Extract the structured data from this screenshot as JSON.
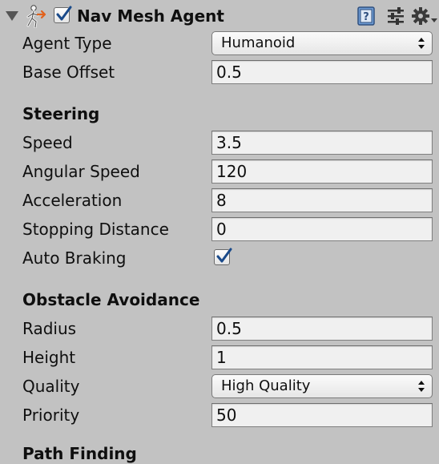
{
  "header": {
    "title": "Nav Mesh Agent",
    "enabled": true,
    "icons": [
      "nav-mesh-agent-icon",
      "help-icon",
      "presets-icon",
      "gear-icon"
    ]
  },
  "fields": {
    "agent_type": {
      "label": "Agent Type",
      "value": "Humanoid"
    },
    "base_offset": {
      "label": "Base Offset",
      "value": "0.5"
    }
  },
  "steering": {
    "title": "Steering",
    "speed": {
      "label": "Speed",
      "value": "3.5"
    },
    "angular_speed": {
      "label": "Angular Speed",
      "value": "120"
    },
    "acceleration": {
      "label": "Acceleration",
      "value": "8"
    },
    "stopping_distance": {
      "label": "Stopping Distance",
      "value": "0"
    },
    "auto_braking": {
      "label": "Auto Braking",
      "checked": true
    }
  },
  "obstacle_avoidance": {
    "title": "Obstacle Avoidance",
    "radius": {
      "label": "Radius",
      "value": "0.5"
    },
    "height": {
      "label": "Height",
      "value": "1"
    },
    "quality": {
      "label": "Quality",
      "value": "High Quality"
    },
    "priority": {
      "label": "Priority",
      "value": "50"
    }
  },
  "path_finding": {
    "title": "Path Finding"
  },
  "colors": {
    "panel_background": "#c2c2c2",
    "field_background": "#f0f0f0",
    "checkmark": "#1a4a8a"
  }
}
